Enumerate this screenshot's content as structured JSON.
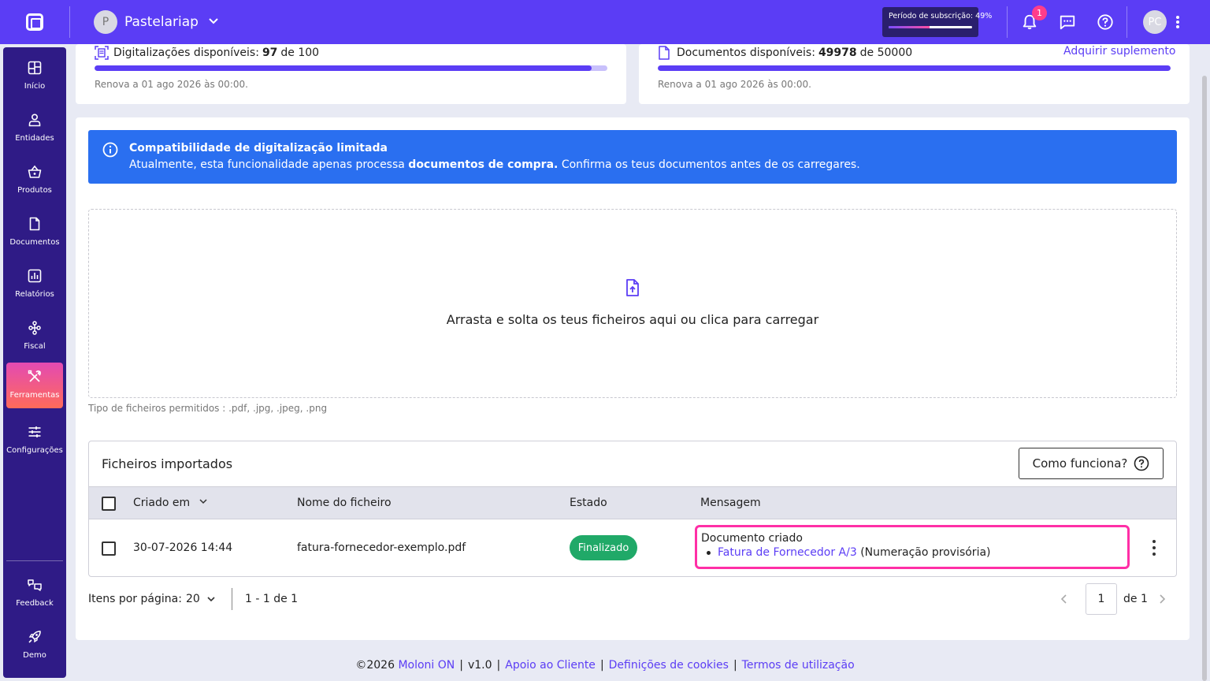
{
  "topbar": {
    "company_initial": "P",
    "company_name": "Pastelariap",
    "subscription_label": "Período de subscrição: 49%",
    "subscription_percent": 49,
    "notification_count": "1",
    "user_initials": "PC"
  },
  "sidebar": {
    "items": [
      {
        "label": "Início",
        "icon": "dashboard-icon"
      },
      {
        "label": "Entidades",
        "icon": "person-icon"
      },
      {
        "label": "Produtos",
        "icon": "basket-icon"
      },
      {
        "label": "Documentos",
        "icon": "document-icon"
      },
      {
        "label": "Relatórios",
        "icon": "report-icon"
      },
      {
        "label": "Fiscal",
        "icon": "fiscal-icon"
      },
      {
        "label": "Ferramentas",
        "icon": "tools-icon",
        "active": true
      },
      {
        "label": "Configurações",
        "icon": "sliders-icon"
      }
    ],
    "bottom": [
      {
        "label": "Feedback",
        "icon": "feedback-icon"
      },
      {
        "label": "Demo",
        "icon": "rocket-icon"
      }
    ]
  },
  "scans": {
    "label": "Digitalizações disponíveis:",
    "available": "97",
    "of_label": "de 100",
    "fraction_available": 0.97,
    "renew": "Renova a 01 ago 2026 às 00:00."
  },
  "docs": {
    "label": "Documentos disponíveis:",
    "available": "49978",
    "of_label": "de 50000",
    "fraction_available": 0.99956,
    "renew": "Renova a 01 ago 2026 às 00:00.",
    "action": "Adquirir suplemento"
  },
  "banner": {
    "title": "Compatibilidade de digitalização limitada",
    "body_start": "Atualmente, esta funcionalidade apenas processa",
    "body_bold": "documentos de compra.",
    "body_end": "Confirma os teus documentos antes de os carregares."
  },
  "dropzone": {
    "text": "Arrasta e solta os teus ficheiros aqui ou clica para carregar",
    "allowed": "Tipo de ficheiros permitidos : .pdf, .jpg, .jpeg, .png"
  },
  "table": {
    "title": "Ficheiros importados",
    "help_button": "Como funciona?",
    "columns": {
      "created": "Criado em",
      "filename": "Nome do ficheiro",
      "status": "Estado",
      "message": "Mensagem"
    },
    "rows": [
      {
        "created": "30-07-2026 14:44",
        "filename": "fatura-fornecedor-exemplo.pdf",
        "status": "Finalizado",
        "message_title": "Documento criado",
        "message_link": "Fatura de Fornecedor A/3",
        "message_note": "(Numeração provisória)"
      }
    ]
  },
  "pagination": {
    "per_page_label": "Itens por página:",
    "per_page": "20",
    "range": "1 - 1 de 1",
    "page": "1",
    "of_pages": "de 1"
  },
  "footer": {
    "copyright": "©2026",
    "brand": "Moloni ON",
    "version": "v1.0",
    "support": "Apoio ao Cliente",
    "cookies": "Definições de cookies",
    "terms": "Termos de utilização"
  },
  "colors": {
    "brand": "#5b3df5",
    "sidebar": "#2f1b86",
    "banner": "#2a6ff0",
    "status_success": "#20a968",
    "highlight": "#ff2fa6"
  }
}
